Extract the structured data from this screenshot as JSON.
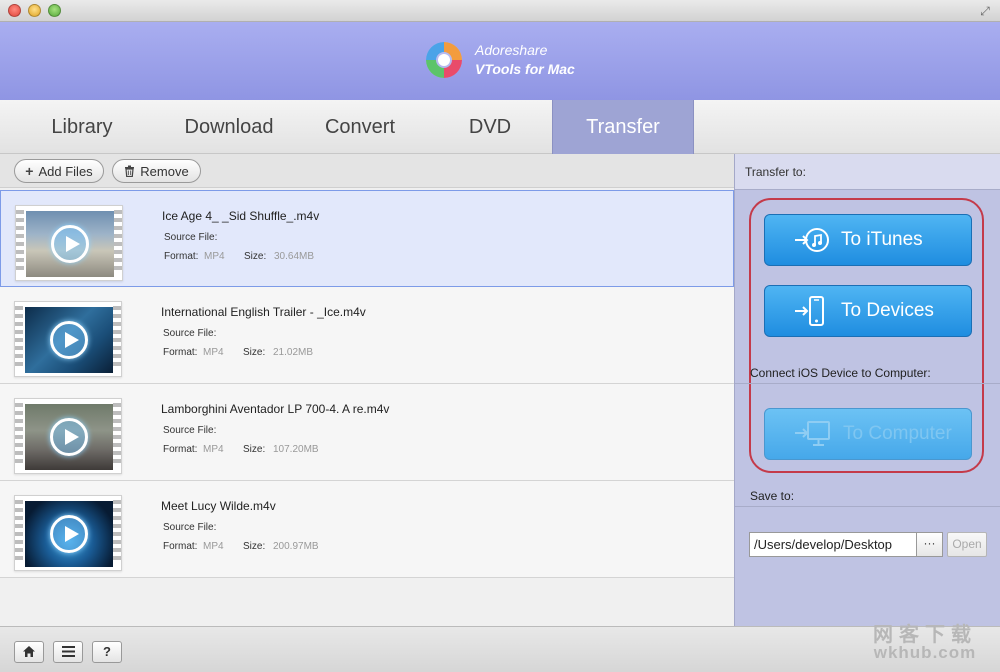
{
  "app": {
    "brand_line1": "Adoreshare",
    "brand_line2": "VTools for Mac"
  },
  "tabs": [
    {
      "label": "Library",
      "active": false
    },
    {
      "label": "Download",
      "active": false
    },
    {
      "label": "Convert",
      "active": false
    },
    {
      "label": "DVD",
      "active": false
    },
    {
      "label": "Transfer",
      "active": true
    }
  ],
  "toolbar": {
    "add_files_label": "Add Files",
    "remove_label": "Remove"
  },
  "file_labels": {
    "source": "Source File:",
    "format": "Format:",
    "size": "Size:"
  },
  "files": [
    {
      "name": "Ice Age 4_ _Sid Shuffle_.m4v",
      "format": "MP4",
      "size": "30.64MB",
      "selected": true
    },
    {
      "name": "International English Trailer - _Ice.m4v",
      "format": "MP4",
      "size": "21.02MB",
      "selected": false
    },
    {
      "name": "Lamborghini Aventador LP 700-4. A re.m4v",
      "format": "MP4",
      "size": "107.20MB",
      "selected": false
    },
    {
      "name": "Meet Lucy Wilde.m4v",
      "format": "MP4",
      "size": "200.97MB",
      "selected": false
    }
  ],
  "transfer": {
    "header": "Transfer to:",
    "to_itunes": "To iTunes",
    "to_devices": "To Devices",
    "connect_label": "Connect iOS Device to Computer:",
    "to_computer": "To Computer",
    "save_to_label": "Save to:",
    "save_path": "/Users/develop/Desktop",
    "browse_label": "···",
    "open_label": "Open"
  },
  "bottom": {
    "help_label": "?"
  },
  "watermark": {
    "line1": "网客下载",
    "line2": "wkhub.com"
  },
  "colors": {
    "accent": "#9ea4d4",
    "button_blue": "#2a93e3",
    "highlight_red": "#c43a4a"
  }
}
